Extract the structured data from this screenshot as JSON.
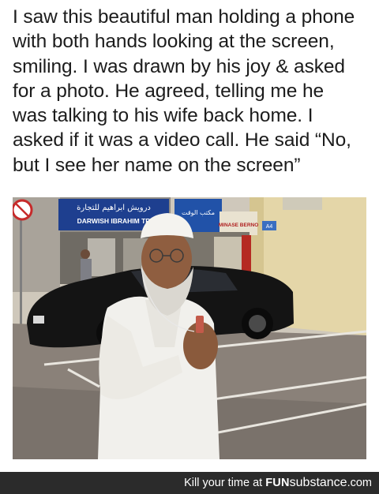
{
  "post": {
    "caption": "I saw this beautiful man holding a phone\nwith both hands looking at the screen,\nsmiling. I was drawn by his joy & asked\nfor a photo. He agreed, telling me he\nwas talking to his wife back home. I\nasked if it was a video call. He said “No,\nbut I see her name on the screen”"
  },
  "photo": {
    "shop_sign_arabic": "درويش ابراهيم للتجارة",
    "shop_sign_english": "DARWISH IBRAHIM TR",
    "shop_sign_2_arabic": "مكتب الوقت",
    "shop_sign_3": "MINASE BERNO",
    "street_sign_text": "A4"
  },
  "footer": {
    "lead": "Kill your time at ",
    "brand_a": "FUN",
    "brand_b": "substance",
    "brand_c": ".com"
  },
  "colors": {
    "footer_bg": "#2b2b2b",
    "car": "#141414",
    "robe": "#f2f1ed",
    "wall": "#e2d3a3"
  }
}
